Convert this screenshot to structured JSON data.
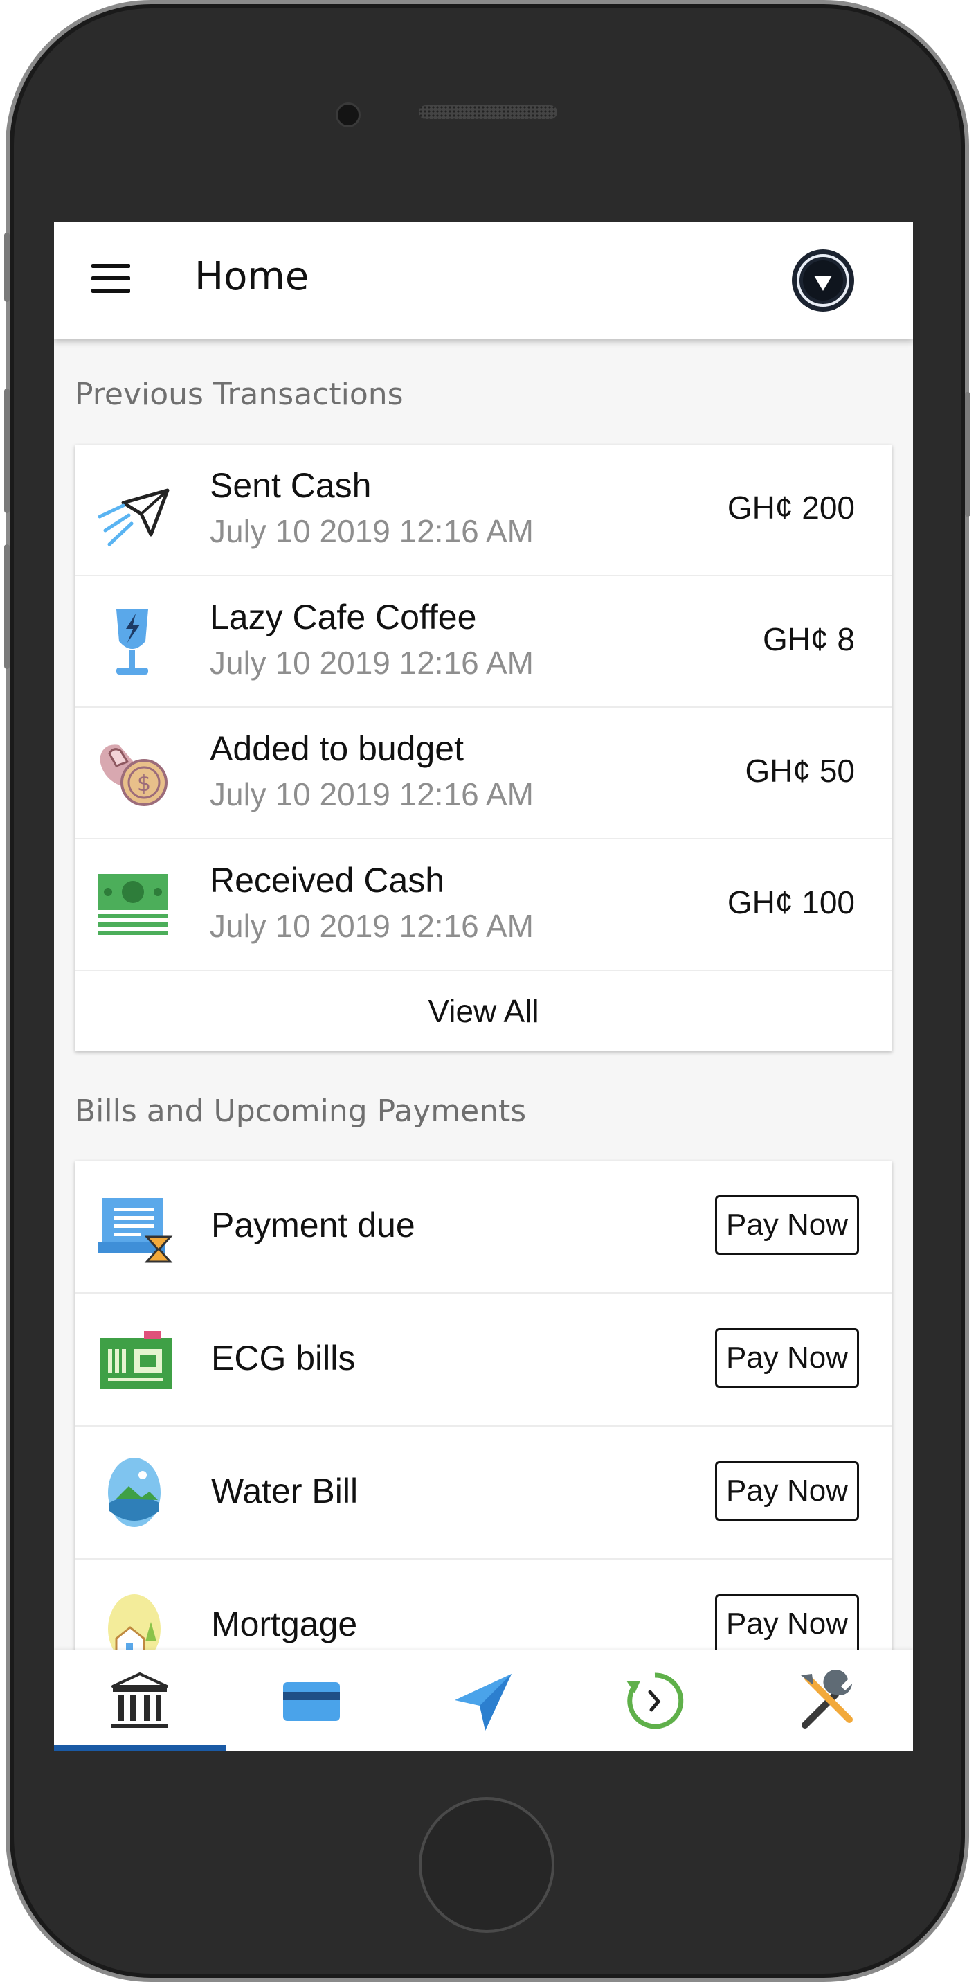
{
  "header": {
    "title": "Home"
  },
  "previous_transactions": {
    "section_title": "Previous Transactions",
    "items": [
      {
        "name": "Sent Cash",
        "date": "July 10 2019 12:16 AM",
        "amount": "GH¢ 200",
        "icon": "paper-plane-icon"
      },
      {
        "name": "Lazy Cafe Coffee",
        "date": "July 10 2019 12:16 AM",
        "amount": "GH¢ 8",
        "icon": "glass-icon"
      },
      {
        "name": "Added to budget",
        "date": "July 10 2019 12:16 AM",
        "amount": "GH¢ 50",
        "icon": "coin-icon"
      },
      {
        "name": "Received Cash",
        "date": "July 10 2019 12:16 AM",
        "amount": "GH¢ 100",
        "icon": "banknotes-icon"
      }
    ],
    "view_all_label": "View All"
  },
  "bills": {
    "section_title": "Bills and Upcoming Payments",
    "pay_label": "Pay Now",
    "items": [
      {
        "name": "Payment due",
        "icon": "invoice-hourglass-icon"
      },
      {
        "name": "ECG bills",
        "icon": "meter-icon"
      },
      {
        "name": "Water Bill",
        "icon": "water-landscape-icon"
      },
      {
        "name": "Mortgage",
        "icon": "house-icon"
      }
    ]
  },
  "bottom_nav": {
    "items": [
      {
        "name": "bank-icon",
        "active": true
      },
      {
        "name": "card-icon",
        "active": false
      },
      {
        "name": "send-icon",
        "active": false
      },
      {
        "name": "history-icon",
        "active": false
      },
      {
        "name": "tools-icon",
        "active": false
      }
    ],
    "active_color": "#1a5aa5"
  }
}
